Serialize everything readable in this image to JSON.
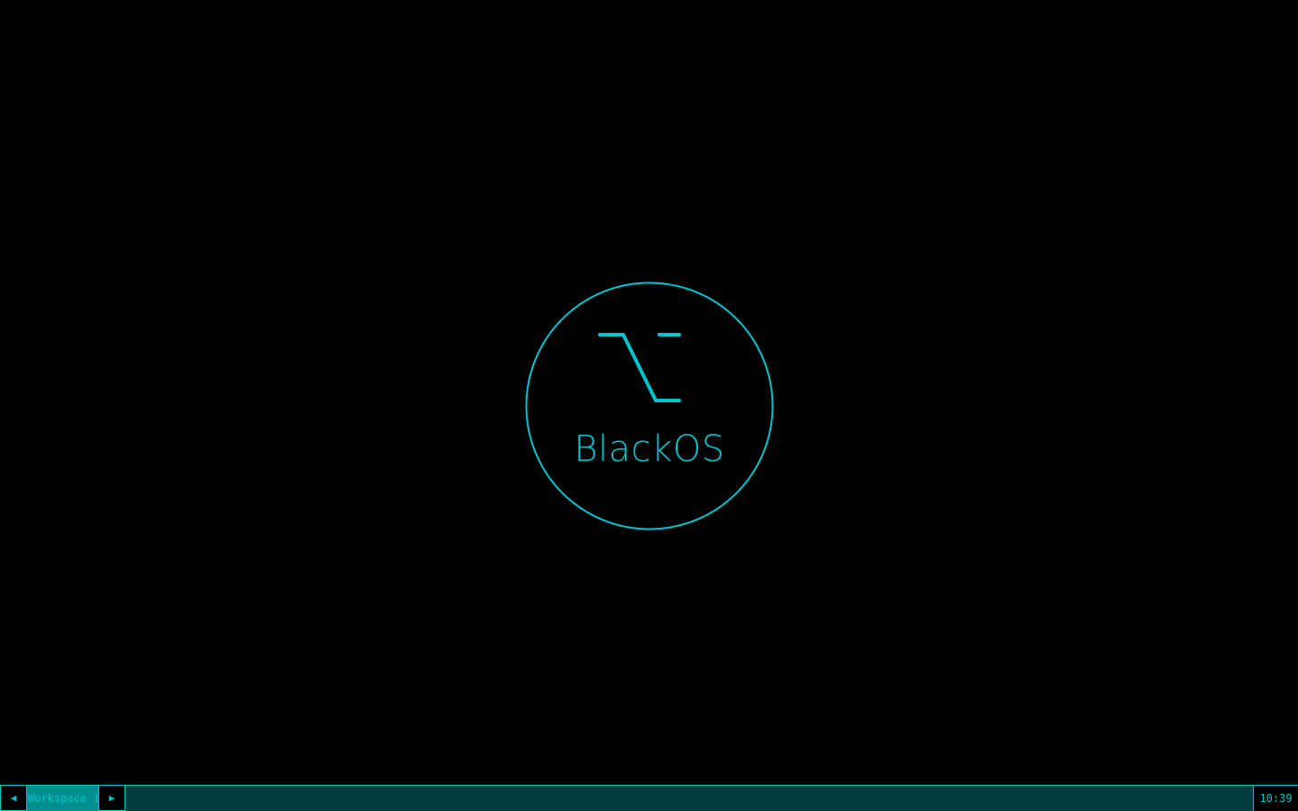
{
  "colors": {
    "accent": "#00c3cc",
    "taskbar_bg": "#003b3d",
    "workspace_active_bg": "#008f8f",
    "background": "#000000"
  },
  "desktop": {
    "logo": {
      "icon": "option-key-icon",
      "text": "BlackOS"
    }
  },
  "taskbar": {
    "prev_icon": "◀",
    "workspace_label": "Workspace 1",
    "next_icon": "▶",
    "clock": "10:39"
  }
}
